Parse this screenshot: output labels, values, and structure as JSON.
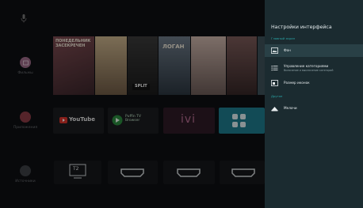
{
  "rail": {
    "items": [
      {
        "label": "Фильмы",
        "color": "#9b6a86"
      },
      {
        "label": "Приложения",
        "color": "#8a3b45"
      },
      {
        "label": "Источники",
        "color": "#3c3f44"
      }
    ]
  },
  "posters": [
    {
      "title": "ПОНЕДЕЛЬНИК\nЗАСЕКРЕЧЕН",
      "bg": "#5d3a40"
    },
    {
      "title": "",
      "bg": "#a28f6c"
    },
    {
      "title": "SPLIT",
      "bg": "#2a2a2a"
    },
    {
      "title": "ЛОГАН",
      "bg": "#4b5a66"
    },
    {
      "title": "",
      "bg": "#9c8880"
    },
    {
      "title": "",
      "bg": "#53403f"
    },
    {
      "title": "",
      "bg": "#3d5058"
    }
  ],
  "apps": [
    {
      "name": "YouTube",
      "bg": "#1b1c1f"
    },
    {
      "name": "Puffin TV Browser",
      "bg": "#1b1c1f"
    },
    {
      "name": "ivi",
      "bg": "#2e1b26"
    },
    {
      "name": "",
      "bg": "#1d7a8c"
    }
  ],
  "inputs": [
    {
      "label": "T2"
    },
    {
      "label": ""
    },
    {
      "label": ""
    },
    {
      "label": ""
    }
  ],
  "panel": {
    "title": "Настройки интерфейса",
    "section_main": "Главный экран",
    "items": [
      {
        "label": "Фон",
        "sub": ""
      },
      {
        "label": "Управление категориями",
        "sub": "Включение и выключение категорий"
      },
      {
        "label": "Размер иконок",
        "sub": ""
      }
    ],
    "section_other": "Другое",
    "extra_items": [
      {
        "label": "Мелочи",
        "sub": ""
      }
    ],
    "accent": "#2aa5a6",
    "bg": "#1b2b30"
  }
}
